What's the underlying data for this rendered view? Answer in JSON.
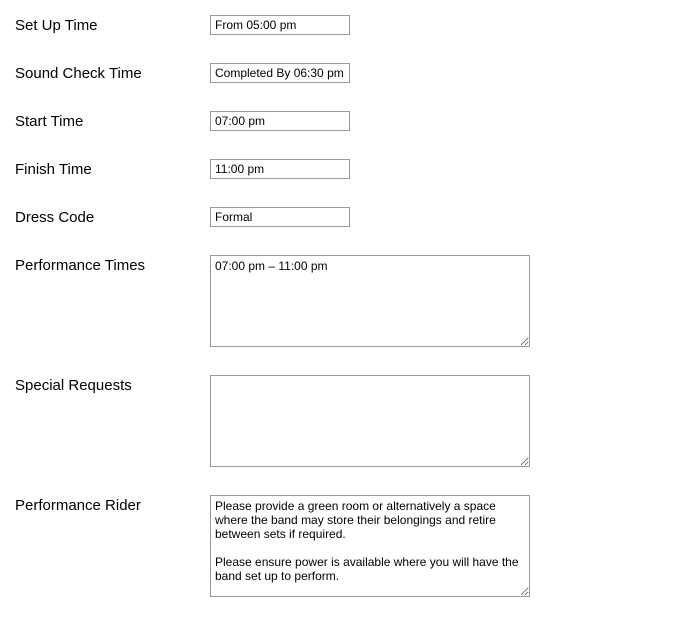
{
  "fields": {
    "setup_time": {
      "label": "Set Up Time",
      "value": "From 05:00 pm"
    },
    "sound_check_time": {
      "label": "Sound Check Time",
      "value": "Completed By 06:30 pm"
    },
    "start_time": {
      "label": "Start Time",
      "value": "07:00 pm"
    },
    "finish_time": {
      "label": "Finish Time",
      "value": "11:00 pm"
    },
    "dress_code": {
      "label": "Dress Code",
      "value": "Formal"
    },
    "performance_times": {
      "label": "Performance Times",
      "value": "07:00 pm – 11:00 pm"
    },
    "special_requests": {
      "label": "Special Requests",
      "value": ""
    },
    "performance_rider": {
      "label": "Performance Rider",
      "value": "Please provide a green room or alternatively a space where the band may store their belongings and retire between sets if required.\n\nPlease ensure power is available where you will have the band set up to perform."
    }
  }
}
